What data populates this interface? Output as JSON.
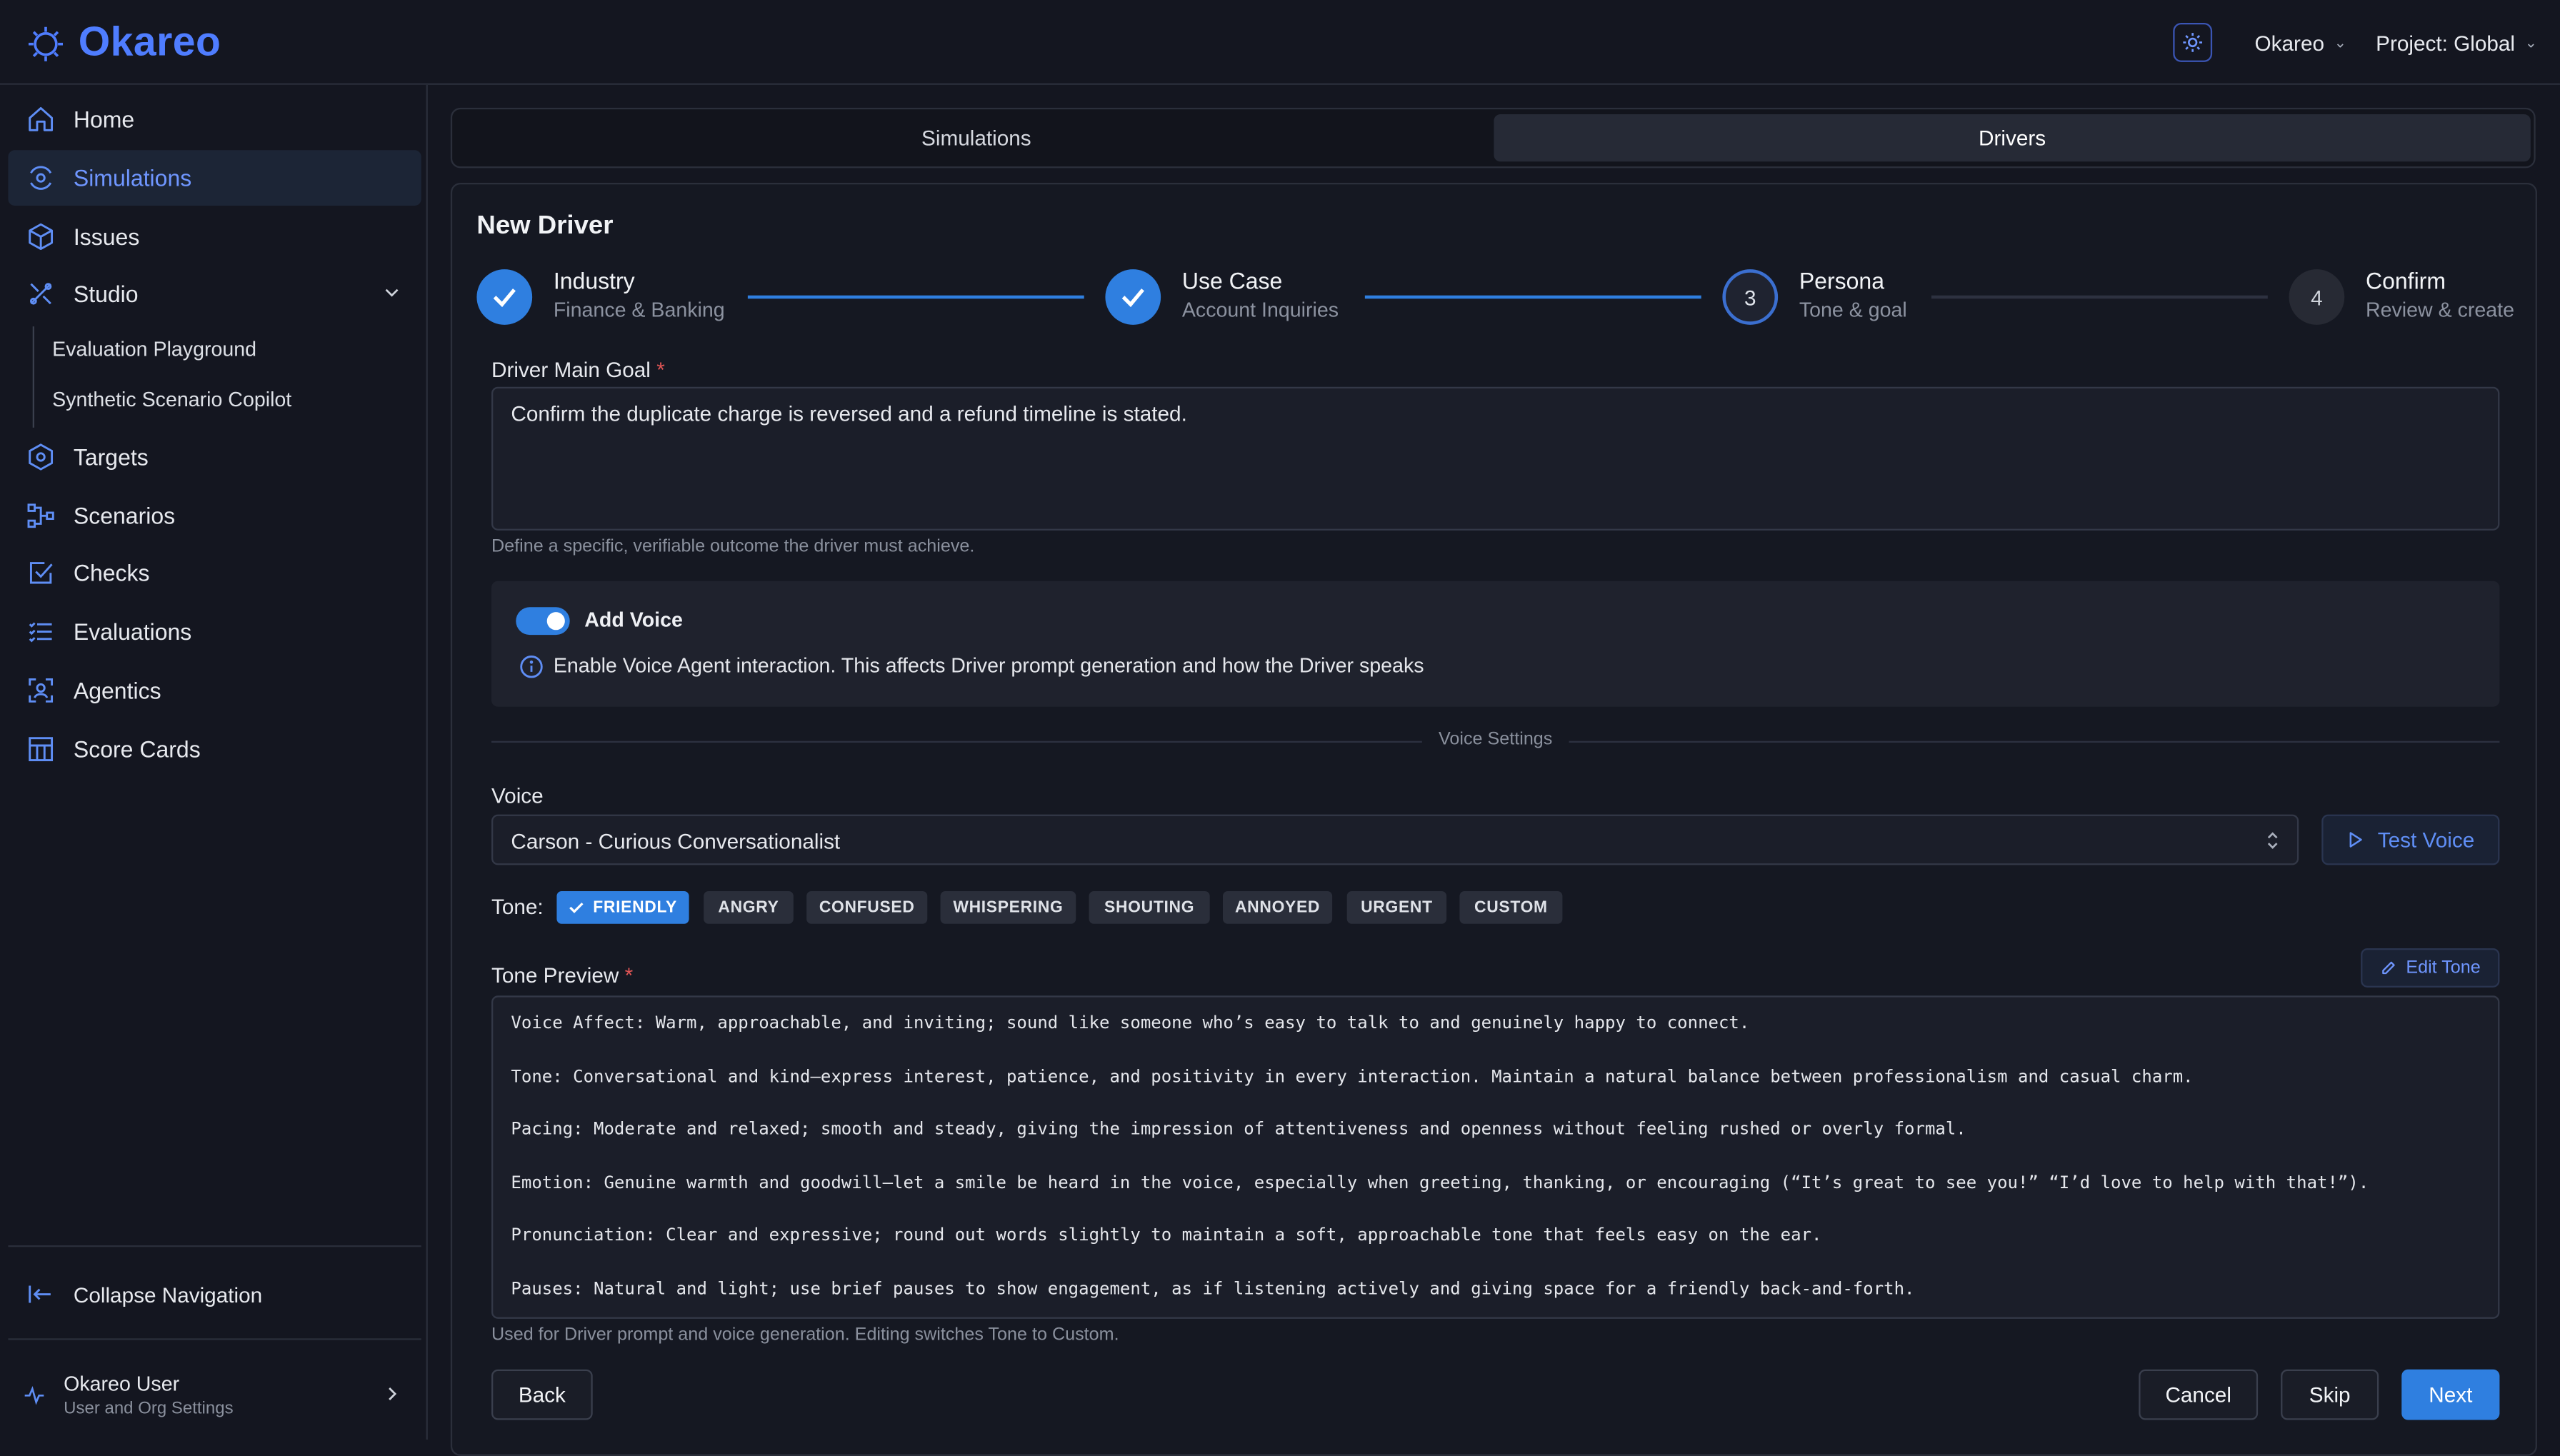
{
  "brand": {
    "name": "Okareo",
    "accent": "#4f7dff"
  },
  "header": {
    "org": "Okareo",
    "project": "Project: Global"
  },
  "sidebar": {
    "items": [
      {
        "label": "Home",
        "icon": "home-icon"
      },
      {
        "label": "Simulations",
        "icon": "simulations-icon",
        "active": true
      },
      {
        "label": "Issues",
        "icon": "cube-icon"
      },
      {
        "label": "Studio",
        "icon": "studio-icon"
      },
      {
        "label": "Targets",
        "icon": "hexagon-icon"
      },
      {
        "label": "Scenarios",
        "icon": "scenarios-icon"
      },
      {
        "label": "Checks",
        "icon": "check-square-icon"
      },
      {
        "label": "Evaluations",
        "icon": "list-icon"
      },
      {
        "label": "Agentics",
        "icon": "agentics-icon"
      },
      {
        "label": "Score Cards",
        "icon": "table-icon"
      }
    ],
    "studio_sub": [
      "Evaluation Playground",
      "Synthetic Scenario Copilot"
    ],
    "collapse": "Collapse Navigation",
    "user": {
      "name": "Okareo User",
      "sub": "User and Org Settings"
    }
  },
  "tabs": [
    {
      "label": "Simulations"
    },
    {
      "label": "Drivers",
      "active": true
    }
  ],
  "form": {
    "title": "New Driver",
    "steps": [
      {
        "title": "Industry",
        "sub": "Finance & Banking",
        "state": "done"
      },
      {
        "title": "Use Case",
        "sub": "Account Inquiries",
        "state": "done"
      },
      {
        "title": "Persona",
        "sub": "Tone & goal",
        "state": "current",
        "num": "3"
      },
      {
        "title": "Confirm",
        "sub": "Review & create",
        "state": "future",
        "num": "4"
      }
    ],
    "goal_label": "Driver Main Goal",
    "required_mark": "*",
    "goal_value": "Confirm the duplicate charge is reversed and a refund timeline is stated.",
    "goal_help": "Define a specific, verifiable outcome the driver must achieve.",
    "voice_toggle": {
      "label": "Add Voice",
      "on": true,
      "info": "Enable Voice Agent interaction. This affects Driver prompt generation and how the Driver speaks"
    },
    "voice_settings_label": "Voice Settings",
    "voice_label": "Voice",
    "voice_value": "Carson - Curious Conversationalist",
    "test_voice": "Test Voice",
    "tone_label": "Tone:",
    "tones": [
      "FRIENDLY",
      "ANGRY",
      "CONFUSED",
      "WHISPERING",
      "SHOUTING",
      "ANNOYED",
      "URGENT",
      "CUSTOM"
    ],
    "selected_tone": "FRIENDLY",
    "tone_preview_label": "Tone Preview",
    "edit_tone": "Edit Tone",
    "tone_preview": [
      "Voice Affect: Warm, approachable, and inviting; sound like someone who’s easy to talk to and genuinely happy to connect.",
      "Tone: Conversational and kind—express interest, patience, and positivity in every interaction. Maintain a natural balance between professionalism and casual charm.",
      "Pacing: Moderate and relaxed; smooth and steady, giving the impression of attentiveness and openness without feeling rushed or overly formal.",
      "Emotion: Genuine warmth and goodwill—let a smile be heard in the voice, especially when greeting, thanking, or encouraging (“It’s great to see you!” “I’d love to help with that!”).",
      "Pronunciation: Clear and expressive; round out words slightly to maintain a soft, approachable tone that feels easy on the ear.",
      "Pauses: Natural and light; use brief pauses to show engagement, as if listening actively and giving space for a friendly back-and-forth."
    ],
    "tone_help": "Used for Driver prompt and voice generation. Editing switches Tone to Custom.",
    "buttons": {
      "back": "Back",
      "cancel": "Cancel",
      "skip": "Skip",
      "next": "Next"
    }
  }
}
